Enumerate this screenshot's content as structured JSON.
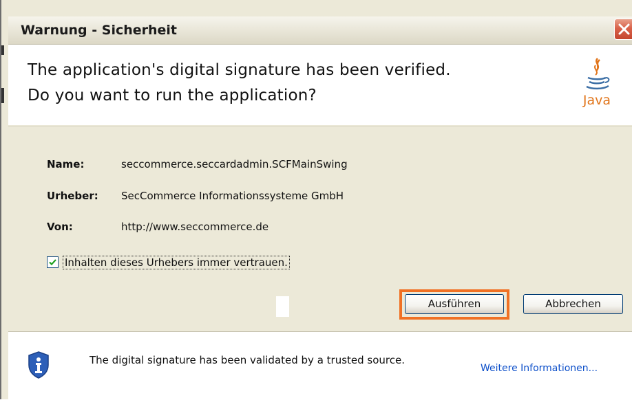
{
  "window": {
    "title": "Warnung - Sicherheit",
    "close_icon": "close-icon"
  },
  "header": {
    "line1": "The application's digital signature has been verified.",
    "line2": "Do you want to run the application?",
    "logo_icon": "java-logo",
    "logo_text": "Java"
  },
  "details": {
    "name_label": "Name:",
    "name_value": "seccommerce.seccardadmin.SCFMainSwing",
    "publisher_label": "Urheber:",
    "publisher_value": "SecCommerce Informationssysteme GmbH",
    "from_label": "Von:",
    "from_value": "http://www.seccommerce.de"
  },
  "trust_checkbox": {
    "label": "Inhalten dieses Urhebers immer vertrauen.",
    "checked": true
  },
  "buttons": {
    "run": "Ausführen",
    "cancel": "Abbrechen"
  },
  "highlight_color": "#f07124",
  "footer": {
    "icon": "shield-info-icon",
    "message": "The digital signature has been validated by a trusted source.",
    "more_info": "Weitere Informationen..."
  }
}
